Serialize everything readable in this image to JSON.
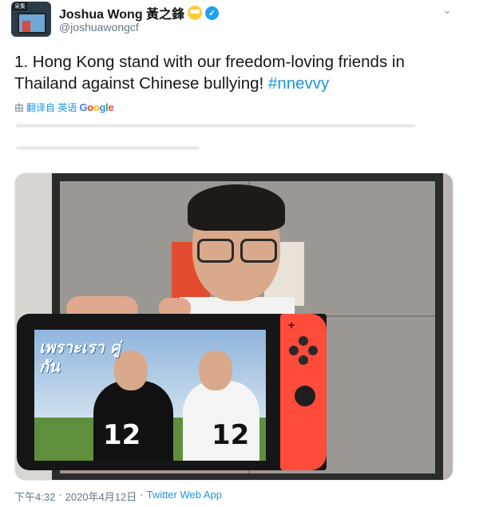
{
  "user": {
    "badge": "采集",
    "display_name": "Joshua Wong 黃之鋒",
    "handle": "@joshuawongcf"
  },
  "tweet": {
    "text_before": "1. Hong Kong stand with our freedom-loving friends in Thailand against Chinese bullying! ",
    "hashtag": "#nnevvy",
    "translate_prefix": "由",
    "translate_link": "翻译自 英语",
    "google_letters": [
      "G",
      "o",
      "o",
      "g",
      "l",
      "e"
    ]
  },
  "media": {
    "show_title": "เพราะเรา คู่กัน",
    "jersey_left": "12",
    "jersey_right": "12"
  },
  "meta": {
    "time": "下午4:32",
    "separator1": "·",
    "date": "2020年4月12日",
    "separator2": "·",
    "source": "Twitter Web App"
  },
  "colors": {
    "link": "#1b95e0",
    "verified": "#1da1f2",
    "secondary_text": "#657786"
  },
  "icons": [
    "verified-icon",
    "emoji-icon",
    "more-icon"
  ]
}
